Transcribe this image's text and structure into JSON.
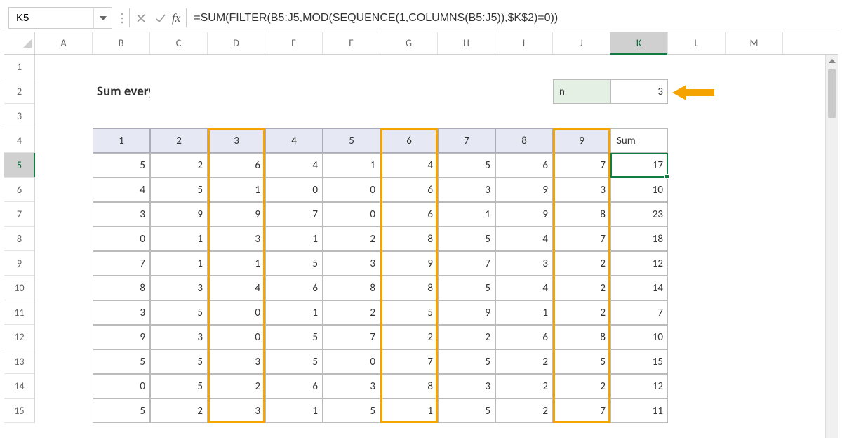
{
  "colors": {
    "accent": "#107c41",
    "highlight": "#f4a300",
    "header_fill": "#e6e9f3",
    "n_fill": "#e3f0e3"
  },
  "namebox": {
    "value": "K5"
  },
  "formula_bar": {
    "fx_label": "fx",
    "formula": "=SUM(FILTER(B5:J5,MOD(SEQUENCE(1,COLUMNS(B5:J5)),$K$2)=0))"
  },
  "columns": [
    "A",
    "B",
    "C",
    "D",
    "E",
    "F",
    "G",
    "H",
    "I",
    "J",
    "K",
    "L",
    "M"
  ],
  "selected_column": "K",
  "row_numbers": [
    "1",
    "2",
    "3",
    "4",
    "5",
    "6",
    "7",
    "8",
    "9",
    "10",
    "11",
    "12",
    "13",
    "14",
    "15"
  ],
  "selected_row": "5",
  "title": "Sum every nth column",
  "n_label": "n",
  "n_value": "3",
  "table": {
    "headers": [
      "1",
      "2",
      "3",
      "4",
      "5",
      "6",
      "7",
      "8",
      "9",
      "Sum"
    ],
    "rows": [
      [
        "5",
        "2",
        "6",
        "4",
        "1",
        "4",
        "5",
        "6",
        "7",
        "17"
      ],
      [
        "4",
        "5",
        "1",
        "0",
        "0",
        "6",
        "3",
        "9",
        "3",
        "10"
      ],
      [
        "3",
        "9",
        "9",
        "7",
        "0",
        "6",
        "1",
        "9",
        "8",
        "23"
      ],
      [
        "0",
        "1",
        "3",
        "1",
        "2",
        "8",
        "5",
        "4",
        "7",
        "18"
      ],
      [
        "7",
        "1",
        "1",
        "5",
        "3",
        "9",
        "7",
        "3",
        "2",
        "12"
      ],
      [
        "8",
        "3",
        "4",
        "6",
        "8",
        "8",
        "5",
        "4",
        "2",
        "14"
      ],
      [
        "3",
        "5",
        "0",
        "1",
        "2",
        "5",
        "9",
        "1",
        "2",
        "7"
      ],
      [
        "9",
        "3",
        "0",
        "5",
        "7",
        "2",
        "2",
        "6",
        "8",
        "10"
      ],
      [
        "5",
        "5",
        "3",
        "5",
        "0",
        "7",
        "5",
        "2",
        "5",
        "15"
      ],
      [
        "0",
        "5",
        "2",
        "6",
        "3",
        "8",
        "3",
        "2",
        "2",
        "12"
      ],
      [
        "5",
        "2",
        "3",
        "1",
        "5",
        "1",
        "5",
        "2",
        "7",
        "11"
      ]
    ]
  },
  "chart_data": {
    "type": "table",
    "title": "Sum every nth column",
    "headers": [
      "1",
      "2",
      "3",
      "4",
      "5",
      "6",
      "7",
      "8",
      "9",
      "Sum"
    ],
    "rows": [
      [
        5,
        2,
        6,
        4,
        1,
        4,
        5,
        6,
        7,
        17
      ],
      [
        4,
        5,
        1,
        0,
        0,
        6,
        3,
        9,
        3,
        10
      ],
      [
        3,
        9,
        9,
        7,
        0,
        6,
        1,
        9,
        8,
        23
      ],
      [
        0,
        1,
        3,
        1,
        2,
        8,
        5,
        4,
        7,
        18
      ],
      [
        7,
        1,
        1,
        5,
        3,
        9,
        7,
        3,
        2,
        12
      ],
      [
        8,
        3,
        4,
        6,
        8,
        8,
        5,
        4,
        2,
        14
      ],
      [
        3,
        5,
        0,
        1,
        2,
        5,
        9,
        1,
        2,
        7
      ],
      [
        9,
        3,
        0,
        5,
        7,
        2,
        2,
        6,
        8,
        10
      ],
      [
        5,
        5,
        3,
        5,
        0,
        7,
        5,
        2,
        5,
        15
      ],
      [
        0,
        5,
        2,
        6,
        3,
        8,
        3,
        2,
        2,
        12
      ],
      [
        5,
        2,
        3,
        1,
        5,
        1,
        5,
        2,
        7,
        11
      ]
    ],
    "n": 3,
    "highlighted_columns": [
      3,
      6,
      9
    ],
    "formula": "=SUM(FILTER(B5:J5,MOD(SEQUENCE(1,COLUMNS(B5:J5)),$K$2)=0))",
    "active_cell": "K5"
  }
}
